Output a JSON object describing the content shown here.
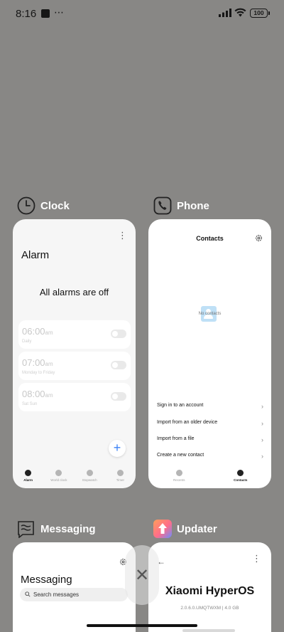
{
  "status_bar": {
    "time": "8:16",
    "dots": "⋯",
    "battery": "100"
  },
  "apps": {
    "clock": {
      "name": "Clock",
      "more": "⋮",
      "screen_title": "Alarm",
      "empty_message": "All alarms are off",
      "alarms": [
        {
          "time": "06:00",
          "ampm": "am",
          "repeat": "Daily",
          "enabled": false
        },
        {
          "time": "07:00",
          "ampm": "am",
          "repeat": "Monday to Friday",
          "enabled": false
        },
        {
          "time": "08:00",
          "ampm": "am",
          "repeat": "Sat Sun",
          "enabled": false
        }
      ],
      "add_button": "+",
      "tabs": [
        "Alarm",
        "World clock",
        "Stopwatch",
        "Timer"
      ],
      "active_tab": "Alarm"
    },
    "phone": {
      "name": "Phone",
      "screen_title": "Contacts",
      "empty_message": "No contacts",
      "actions": [
        "Sign in to an account",
        "Import from an older device",
        "Import from a file",
        "Create a new contact"
      ],
      "chevron": "›",
      "tabs": [
        "Recents",
        "Contacts"
      ],
      "active_tab": "Contacts"
    },
    "messaging": {
      "name": "Messaging",
      "screen_title": "Messaging",
      "search_placeholder": "Search messages"
    },
    "updater": {
      "name": "Updater",
      "back": "←",
      "more": "⋮",
      "os_name": "Xiaomi HyperOS",
      "version": "2.0.6.0.UMQTWXM | 4.0 GB"
    }
  },
  "close_button": "✕",
  "colors": {
    "background": "#888785",
    "card": "#f6f6f6",
    "accent_blue": "#3b82f6",
    "contact_icon": "#bfe0f6"
  }
}
